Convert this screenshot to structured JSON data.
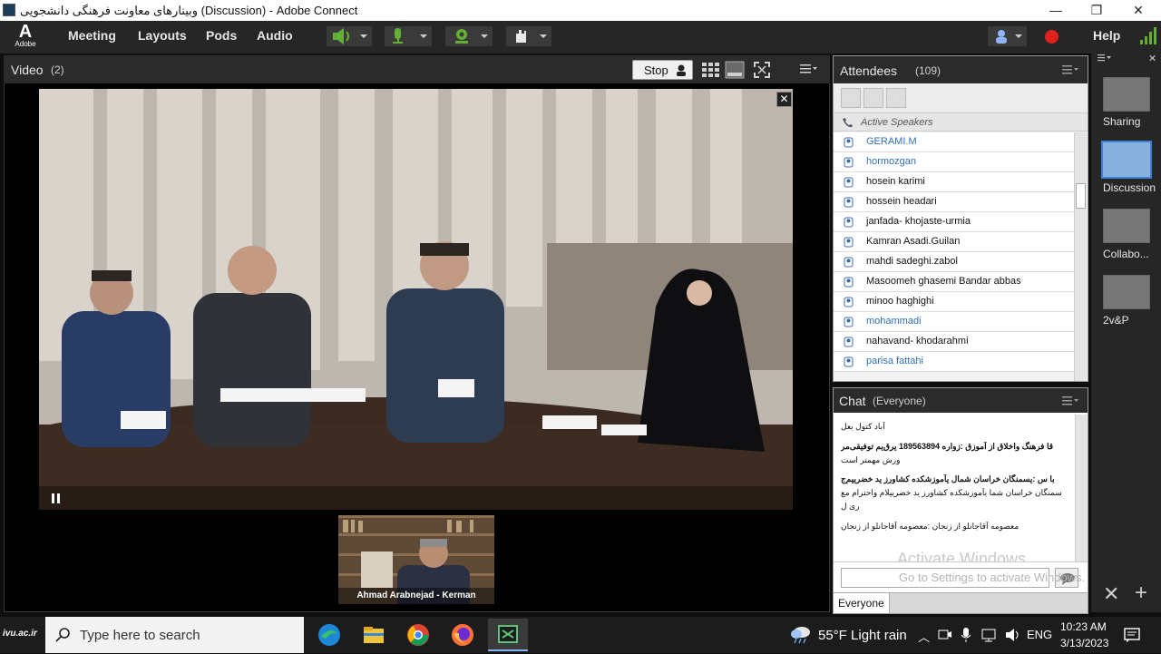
{
  "window": {
    "title": "وبینارهای معاونت فرهنگی دانشجویی (Discussion) - Adobe Connect",
    "minimize": "—",
    "maximize": "❐",
    "close": "✕"
  },
  "menubar": {
    "logo": "A",
    "logo_sub": "Adobe",
    "items": [
      "Meeting",
      "Layouts",
      "Pods",
      "Audio"
    ],
    "help": "Help"
  },
  "video_pod": {
    "title": "Video",
    "count": "(2)",
    "stop_label": "Stop",
    "overlay_name": "Ahmad Arabnejad - Kerman"
  },
  "attendees_pod": {
    "title": "Attendees",
    "count": "(109)",
    "section": "Active Speakers",
    "list": [
      {
        "name": "GERAMI.M",
        "color": "#2f6fb5"
      },
      {
        "name": "hormozgan",
        "color": "#2f6fb5"
      },
      {
        "name": "hosein karimi",
        "color": "#111111"
      },
      {
        "name": "hossein headari",
        "color": "#111111"
      },
      {
        "name": "janfada- khojaste-urmia",
        "color": "#111111"
      },
      {
        "name": "Kamran Asadi.Guilan",
        "color": "#111111"
      },
      {
        "name": "mahdi sadeghi.zabol",
        "color": "#111111"
      },
      {
        "name": "Masoomeh ghasemi Bandar abbas",
        "color": "#111111"
      },
      {
        "name": "minoo haghighi",
        "color": "#111111"
      },
      {
        "name": "mohammadi",
        "color": "#2f6fb5"
      },
      {
        "name": "nahavand- khodarahmi",
        "color": "#111111"
      },
      {
        "name": "parisa fattahi",
        "color": "#2f6fb5"
      }
    ]
  },
  "chat_pod": {
    "title": "Chat",
    "scope": "(Everyone)",
    "recipient": "Everyone",
    "messages": [
      "آباد کتول یعل",
      "قا فرهنگ واخلاق از آموزق :زواره 189563894 یرق‌یم توفیقی‌مر",
      "ورش مهمتر است",
      "با س :یسمنگان خراسان شمال یآموزشکده کشاورز ید خضرییم‌ج",
      "سمنگان خراسان شما یآموزشکده کشاورز ید خضرییلام واحترام مع",
      "ری ل",
      "معصومه آقاجانلو از زنجان :معصومه آقاجانلو از زنجان"
    ],
    "watermark1": "Activate Windows",
    "watermark2": "Go to Settings to activate Windows."
  },
  "layouts": [
    {
      "label": "Sharing"
    },
    {
      "label": "Discussion"
    },
    {
      "label": "Collabo..."
    },
    {
      "label": "2v&P"
    }
  ],
  "taskbar": {
    "start_label": "ivu.ac.ir",
    "search_placeholder": "Type here to search",
    "weather": "55°F  Light rain",
    "lang": "ENG",
    "time": "10:23 AM",
    "date": "3/13/2023"
  },
  "colors": {
    "accent": "#2f6fb5",
    "record": "#e0201a",
    "mic": "#62b033"
  }
}
